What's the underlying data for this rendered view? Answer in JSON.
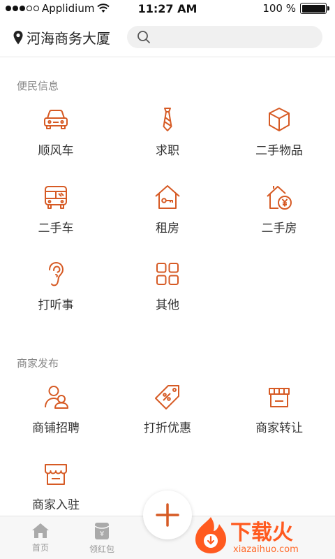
{
  "status_bar": {
    "carrier": "Applidium",
    "time": "11:27 AM",
    "battery": "100 %"
  },
  "header": {
    "location": "河海商务大厦",
    "search_placeholder": ""
  },
  "sections": [
    {
      "title": "便民信息",
      "items": [
        {
          "label": "顺风车",
          "icon": "car-icon"
        },
        {
          "label": "求职",
          "icon": "tie-icon"
        },
        {
          "label": "二手物品",
          "icon": "box-icon"
        },
        {
          "label": "二手车",
          "icon": "bus-icon"
        },
        {
          "label": "租房",
          "icon": "house-key-icon"
        },
        {
          "label": "二手房",
          "icon": "house-yen-icon"
        },
        {
          "label": "打听事",
          "icon": "ear-icon"
        },
        {
          "label": "其他",
          "icon": "grid-icon"
        }
      ]
    },
    {
      "title": "商家发布",
      "items": [
        {
          "label": "商铺招聘",
          "icon": "users-icon"
        },
        {
          "label": "打折优惠",
          "icon": "discount-tag-icon"
        },
        {
          "label": "商家转让",
          "icon": "storefront-icon"
        },
        {
          "label": "商家入驻",
          "icon": "store-enter-icon"
        }
      ]
    }
  ],
  "bottom_nav": {
    "tabs": [
      {
        "label": "首页",
        "icon": "home-icon"
      },
      {
        "label": "领红包",
        "icon": "red-packet-icon"
      }
    ],
    "fab_icon": "plus-icon"
  },
  "watermark": {
    "text_cn": "下载火",
    "text_en": "xiazaihuo.com"
  },
  "colors": {
    "accent": "#d65a24",
    "section_title": "#888888",
    "tab_inactive": "#999999"
  }
}
